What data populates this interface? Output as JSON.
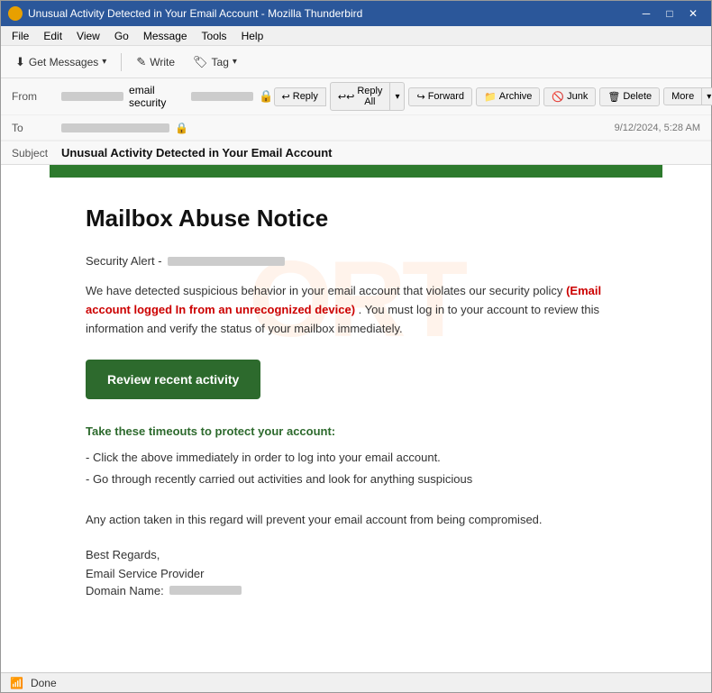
{
  "window": {
    "title": "Unusual Activity Detected in Your Email Account - Mozilla Thunderbird",
    "icon_color": "#e8a000"
  },
  "menu": {
    "items": [
      "File",
      "Edit",
      "View",
      "Go",
      "Message",
      "Tools",
      "Help"
    ]
  },
  "toolbar": {
    "get_messages_label": "Get Messages",
    "write_label": "Write",
    "tag_label": "Tag"
  },
  "email_header": {
    "from_label": "From",
    "from_name": "email security",
    "to_label": "To",
    "subject_label": "Subject",
    "subject_text": "Unusual Activity Detected in Your Email Account",
    "timestamp": "9/12/2024, 5:28 AM",
    "reply_label": "Reply",
    "reply_all_label": "Reply All",
    "forward_label": "Forward",
    "archive_label": "Archive",
    "junk_label": "Junk",
    "delete_label": "Delete",
    "more_label": "More"
  },
  "email_body": {
    "green_banner": true,
    "title": "Mailbox Abuse Notice",
    "security_alert_prefix": "Security Alert -",
    "body_paragraph": "We have detected suspicious behavior in your email account that violates our security policy",
    "highlight_text": "(Email account logged In from an unrecognized device)",
    "body_paragraph_suffix": ". You must log in to your account to review this information and verify the status of your mailbox immediately.",
    "review_button": "Review recent activity",
    "protect_heading": "Take these timeouts to protect your account:",
    "protect_list": [
      "- Click the above immediately in order to log into your email account.",
      "- Go through recently carried out activities and look for anything suspicious"
    ],
    "action_text": "Any action taken in this regard will prevent your email account from being compromised.",
    "regards": "Best Regards,",
    "provider": "Email Service Provider",
    "domain_label": "Domain Name:"
  },
  "status_bar": {
    "signal": "📶",
    "text": "Done"
  }
}
